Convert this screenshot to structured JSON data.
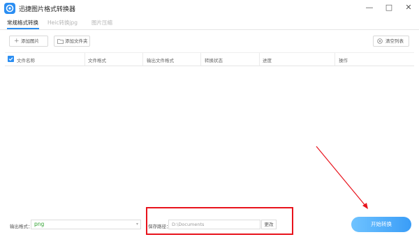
{
  "app": {
    "title": "迅捷图片格式转换器"
  },
  "window_controls": {
    "minimize": "—",
    "maximize": "□",
    "close": "✕"
  },
  "tabs": [
    {
      "label": "常规格式转换",
      "active": true
    },
    {
      "label": "Heic转换jpg",
      "active": false
    },
    {
      "label": "图片压缩",
      "active": false
    }
  ],
  "toolbar": {
    "add_image": "添加图片",
    "add_folder": "添加文件夹",
    "clear_list": "清空列表"
  },
  "table": {
    "columns": [
      "文件名称",
      "文件格式",
      "输出文件格式",
      "转换状态",
      "进度",
      "操作"
    ],
    "rows": []
  },
  "bottom": {
    "output_format_label": "输出格式：",
    "output_format_value": "png",
    "save_path_label": "保存路径：",
    "save_path_value": "D:\\Documents",
    "change_button": "更改",
    "start_button": "开始转换"
  },
  "colors": {
    "accent": "#2b8ef2",
    "format_value": "#2ca02c",
    "annotation": "#e8131c"
  }
}
